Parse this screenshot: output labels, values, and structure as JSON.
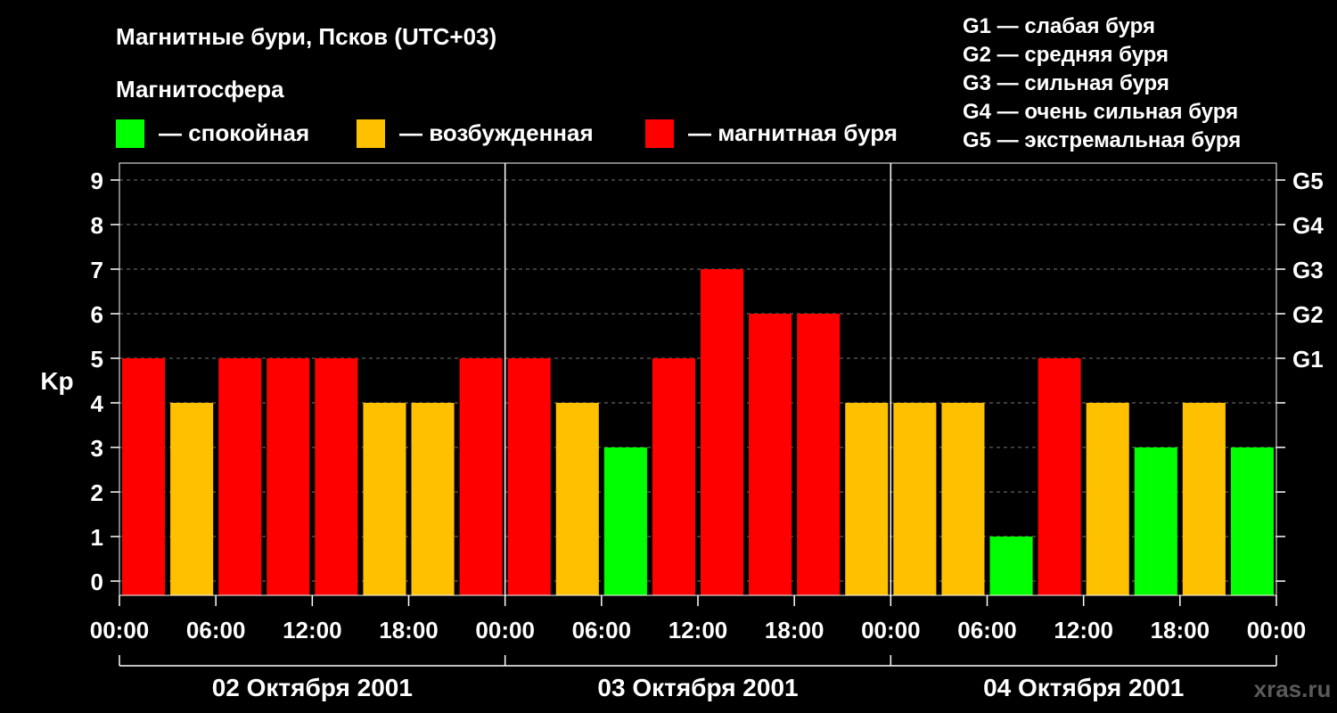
{
  "title": "Магнитные бури, Псков (UTC+03)",
  "legend": {
    "heading": "Магнитосфера",
    "items": [
      {
        "label": "— спокойная",
        "color": "#00ff00"
      },
      {
        "label": "— возбужденная",
        "color": "#ffc000"
      },
      {
        "label": "— магнитная буря",
        "color": "#ff0000"
      }
    ]
  },
  "g_scale": [
    "G1 — слабая буря",
    "G2 — средняя буря",
    "G3 — сильная буря",
    "G4 — очень сильная буря",
    "G5 — экстремальная буря"
  ],
  "watermark": "xras.ru",
  "chart_data": {
    "type": "bar",
    "ylabel": "Kp",
    "ylim": [
      0,
      9
    ],
    "y_ticks": [
      0,
      1,
      2,
      3,
      4,
      5,
      6,
      7,
      8,
      9
    ],
    "right_ticks": [
      {
        "value": 5,
        "label": "G1"
      },
      {
        "value": 6,
        "label": "G2"
      },
      {
        "value": 7,
        "label": "G3"
      },
      {
        "value": 8,
        "label": "G4"
      },
      {
        "value": 9,
        "label": "G5"
      }
    ],
    "x_tick_labels": [
      "00:00",
      "06:00",
      "12:00",
      "18:00",
      "00:00",
      "06:00",
      "12:00",
      "18:00",
      "00:00",
      "06:00",
      "12:00",
      "18:00",
      "00:00"
    ],
    "days": [
      "02 Октября 2001",
      "03 Октября 2001",
      "04 Октября 2001"
    ],
    "bar_interval_hours": 3,
    "values": [
      5,
      4,
      5,
      5,
      5,
      4,
      4,
      5,
      5,
      4,
      3,
      5,
      7,
      6,
      6,
      4,
      4,
      4,
      1,
      5,
      4,
      3,
      4,
      3
    ],
    "colors": {
      "quiet": "#00ff00",
      "active": "#ffc000",
      "storm": "#ff0000"
    },
    "grid": true
  }
}
